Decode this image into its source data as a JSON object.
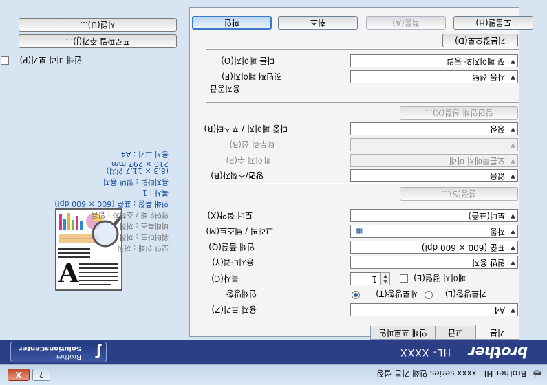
{
  "window": {
    "title": "Brother HL- xxxx series 인쇄 기본 설정",
    "help_label": "?",
    "close_label": "X",
    "app_icon": "printer-icon"
  },
  "brand": {
    "logo": "brother",
    "model": "HL- XXXX",
    "solutions_line1": "Brother",
    "solutions_line2": "SolutionsCenter",
    "solutions_icon": "brother-solutions-icon"
  },
  "tabs": [
    "기본",
    "고급",
    "인쇄 프로파일"
  ],
  "basic": {
    "paper_size_label": "용지 크기(Z)",
    "paper_size_value": "A4",
    "orientation_label": "인쇄방향",
    "portrait_label": "세로방향(T)",
    "landscape_label": "가로방향(L)",
    "copies_label": "복사(C)",
    "copies_value": "1",
    "collate_label": "페이지 정렬(E)",
    "media_type_label": "용지타입(Y)",
    "media_type_value": "일반 용지",
    "resolution_label": "인쇄 품질(Q)",
    "resolution_value": "표준 (600 × 600 dpi)",
    "print_settings_label": "그래픽 / 텍스트(M)",
    "print_settings_value": "자동",
    "print_settings_icon": "document-icon",
    "toner_label": "토너 절약(X)",
    "toner_value": "토너(표준)",
    "settings_button": "설정(S)...",
    "duplex_label": "양면/소책자(B)",
    "duplex_value": "없음",
    "pages_label": "페이지 수(P)",
    "pages_value": "오른쪽에서 아래",
    "border_label": "테두리 선(B)",
    "border_value": "",
    "multiple_label": "다중 페이지 / 포스터(R)",
    "multiple_value": "정상",
    "duplex_settings_button": "양면인쇄 설정(X)...",
    "paper_source_label": "용지공급",
    "first_page_label": "첫번째 페이지(E)",
    "first_page_value": "자동 선택",
    "other_pages_label": "다른 페이지(O)",
    "other_pages_value": "첫 페이지와 동일",
    "default_button": "기본값으로(D)"
  },
  "side": {
    "preview_icon": "print-preview-illustration",
    "info": [
      "용지 크기 : A4",
      "210 × 297 mm",
      "(8.3 × 11.7 인치)",
      "용지타입 : 일반 용지",
      "복사 : 1",
      "인쇄 품질 : 표준 (600 × 600 dpi)",
      "양면인쇄 / 소책자 : 없음",
      "비례축소 : 꺼짐",
      "워터마크 : 꺼짐",
      "보안 인쇄 : 꺼짐"
    ],
    "show_preview_label": "인쇄 미리 보기(P)",
    "add_profile_button": "프로파일 추가(J)...",
    "support_button": "지원(U)..."
  },
  "buttons": {
    "ok": "확인",
    "cancel": "취소",
    "apply": "적용(A)",
    "help": "도움말(H)"
  }
}
